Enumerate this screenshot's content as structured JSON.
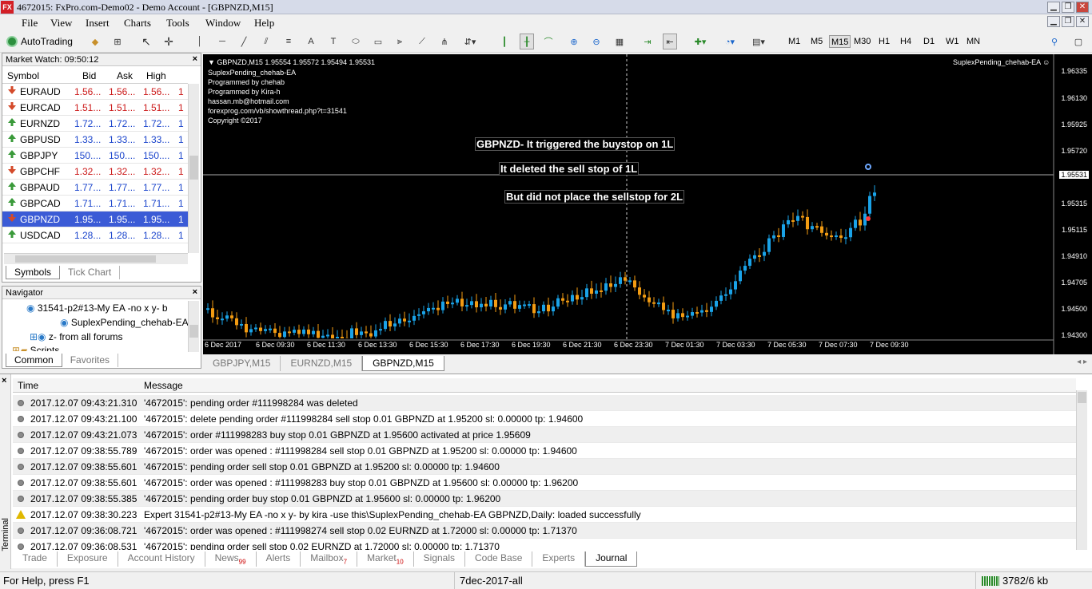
{
  "window": {
    "title": "4672015: FxPro.com-Demo02 - Demo Account - [GBPNZD,M15]",
    "logo_text": "FX"
  },
  "menu": [
    "File",
    "View",
    "Insert",
    "Charts",
    "Tools",
    "Window",
    "Help"
  ],
  "toolbar": {
    "autotrading_label": "AutoTrading",
    "timeframes": [
      "M1",
      "M5",
      "M15",
      "M30",
      "H1",
      "H4",
      "D1",
      "W1",
      "MN"
    ],
    "active_timeframe": "M15"
  },
  "market_watch": {
    "title": "Market Watch: 09:50:12",
    "columns": [
      "Symbol",
      "Bid",
      "Ask",
      "High"
    ],
    "rows": [
      {
        "symbol": "EURAUD",
        "bid": "1.56...",
        "ask": "1.56...",
        "high": "1.56...",
        "extra": "1",
        "dir": "down"
      },
      {
        "symbol": "EURCAD",
        "bid": "1.51...",
        "ask": "1.51...",
        "high": "1.51...",
        "extra": "1",
        "dir": "down"
      },
      {
        "symbol": "EURNZD",
        "bid": "1.72...",
        "ask": "1.72...",
        "high": "1.72...",
        "extra": "1",
        "dir": "up"
      },
      {
        "symbol": "GBPUSD",
        "bid": "1.33...",
        "ask": "1.33...",
        "high": "1.33...",
        "extra": "1",
        "dir": "up"
      },
      {
        "symbol": "GBPJPY",
        "bid": "150....",
        "ask": "150....",
        "high": "150....",
        "extra": "1",
        "dir": "up"
      },
      {
        "symbol": "GBPCHF",
        "bid": "1.32...",
        "ask": "1.32...",
        "high": "1.32...",
        "extra": "1",
        "dir": "down"
      },
      {
        "symbol": "GBPAUD",
        "bid": "1.77...",
        "ask": "1.77...",
        "high": "1.77...",
        "extra": "1",
        "dir": "up"
      },
      {
        "symbol": "GBPCAD",
        "bid": "1.71...",
        "ask": "1.71...",
        "high": "1.71...",
        "extra": "1",
        "dir": "up"
      },
      {
        "symbol": "GBPNZD",
        "bid": "1.95...",
        "ask": "1.95...",
        "high": "1.95...",
        "extra": "1",
        "dir": "down",
        "selected": true
      },
      {
        "symbol": "USDCAD",
        "bid": "1.28...",
        "ask": "1.28...",
        "high": "1.28...",
        "extra": "1",
        "dir": "up"
      }
    ],
    "tabs": [
      "Symbols",
      "Tick Chart"
    ]
  },
  "navigator": {
    "title": "Navigator",
    "items": [
      "31541-p2#13-My EA -no x y- b",
      "SuplexPending_chehab-EA",
      "z- from all forums",
      "Scripts"
    ],
    "tabs": [
      "Common",
      "Favorites"
    ]
  },
  "chart": {
    "header": "GBPNZD,M15  1.95554 1.95572 1.95494 1.95531",
    "info_lines": [
      "SuplexPending_chehab-EA",
      "Programmed by chehab",
      "Programmed by Kira-h",
      "hassan.mb@hotmail.com",
      "forexprog.com/vb/showthread.php?t=31541",
      "Copyright ©2017"
    ],
    "ea_label": "SuplexPending_chehab-EA ☺",
    "annotations": [
      "GBPNZD- It triggered the buystop on 1L",
      "It deleted the sell stop of 1L",
      "But did not place the sellstop for 2L"
    ],
    "price_labels": [
      "1.96335",
      "1.96130",
      "1.95925",
      "1.95720",
      "1.95531",
      "1.95315",
      "1.95115",
      "1.94910",
      "1.94705",
      "1.94500",
      "1.94300"
    ],
    "current_price": "1.95531",
    "time_labels": [
      "6 Dec 2017",
      "6 Dec 09:30",
      "6 Dec 11:30",
      "6 Dec 13:30",
      "6 Dec 15:30",
      "6 Dec 17:30",
      "6 Dec 19:30",
      "6 Dec 21:30",
      "6 Dec 23:30",
      "7 Dec 01:30",
      "7 Dec 03:30",
      "7 Dec 05:30",
      "7 Dec 07:30",
      "7 Dec 09:30"
    ],
    "colors": {
      "bull": "#1aa3e8",
      "bear": "#f39c12",
      "background": "#000000"
    }
  },
  "chart_tabs": [
    "GBPJPY,M15",
    "EURNZD,M15",
    "GBPNZD,M15"
  ],
  "terminal": {
    "side_label": "Terminal",
    "columns": [
      "Time",
      "Message"
    ],
    "rows": [
      {
        "time": "2017.12.07 09:43:21.310",
        "msg": "'4672015': pending order #111998284 was deleted",
        "icon": "dot"
      },
      {
        "time": "2017.12.07 09:43:21.100",
        "msg": "'4672015': delete pending order #111998284 sell stop 0.01 GBPNZD at 1.95200 sl: 0.00000 tp: 1.94600",
        "icon": "dot"
      },
      {
        "time": "2017.12.07 09:43:21.073",
        "msg": "'4672015': order #111998283 buy stop 0.01 GBPNZD at 1.95600 activated at price 1.95609",
        "icon": "dot"
      },
      {
        "time": "2017.12.07 09:38:55.789",
        "msg": "'4672015': order was opened : #111998284 sell stop 0.01 GBPNZD at 1.95200 sl: 0.00000 tp: 1.94600",
        "icon": "dot"
      },
      {
        "time": "2017.12.07 09:38:55.601",
        "msg": "'4672015': pending order sell stop 0.01 GBPNZD at 1.95200 sl: 0.00000 tp: 1.94600",
        "icon": "dot"
      },
      {
        "time": "2017.12.07 09:38:55.601",
        "msg": "'4672015': order was opened : #111998283 buy stop 0.01 GBPNZD at 1.95600 sl: 0.00000 tp: 1.96200",
        "icon": "dot"
      },
      {
        "time": "2017.12.07 09:38:55.385",
        "msg": "'4672015': pending order buy stop 0.01 GBPNZD at 1.95600 sl: 0.00000 tp: 1.96200",
        "icon": "dot"
      },
      {
        "time": "2017.12.07 09:38:30.223",
        "msg": "Expert 31541-p2#13-My EA -no x y- by kira -use this\\SuplexPending_chehab-EA GBPNZD,Daily: loaded successfully",
        "icon": "warn"
      },
      {
        "time": "2017.12.07 09:36:08.721",
        "msg": "'4672015': order was opened : #111998274 sell stop 0.02 EURNZD at 1.72000 sl: 0.00000 tp: 1.71370",
        "icon": "dot"
      },
      {
        "time": "2017.12.07 09:36:08.531",
        "msg": "'4672015': pending order sell stop 0.02 EURNZD at 1.72000 sl: 0.00000 tp: 1.71370",
        "icon": "dot"
      }
    ],
    "tabs": [
      {
        "label": "Trade"
      },
      {
        "label": "Exposure"
      },
      {
        "label": "Account History"
      },
      {
        "label": "News",
        "badge": "99"
      },
      {
        "label": "Alerts"
      },
      {
        "label": "Mailbox",
        "badge": "7"
      },
      {
        "label": "Market",
        "badge": "10"
      },
      {
        "label": "Signals"
      },
      {
        "label": "Code Base"
      },
      {
        "label": "Experts"
      },
      {
        "label": "Journal",
        "active": true
      }
    ]
  },
  "status": {
    "help": "For Help, press F1",
    "profile": "7dec-2017-all",
    "traffic": "3782/6 kb"
  }
}
